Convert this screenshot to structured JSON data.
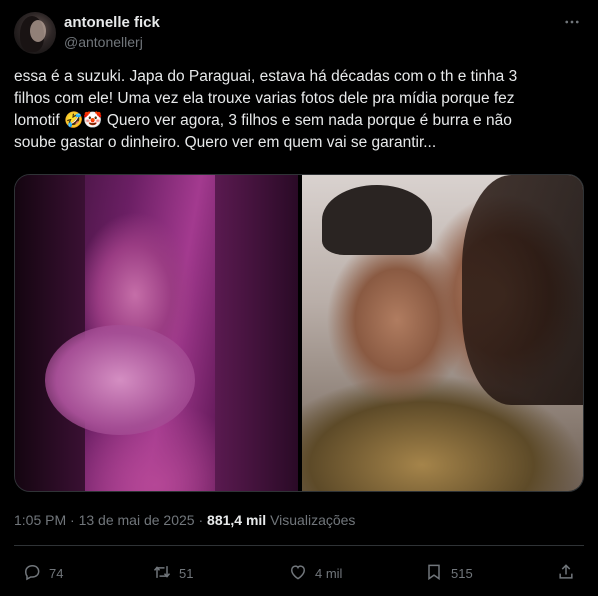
{
  "author": {
    "name": "antonelle fick",
    "handle": "@antonellerj"
  },
  "tweet": {
    "lines": [
      "essa é a suzuki. Japa do Paraguai, estava há décadas com o th e tinha 3",
      "filhos com ele! Uma vez ela trouxe varias fotos dele pra mídia porque fez",
      "lomotif 🤣🤡  Quero ver agora, 3 filhos e sem nada porque é burra e não",
      "soube gastar o dinheiro. Quero ver em quem vai se garantir..."
    ]
  },
  "meta": {
    "time": "1:05 PM",
    "separator": " · ",
    "date": "13 de mai de 2025",
    "views_count": "881,4 mil",
    "views_label": "Visualizações"
  },
  "actions": {
    "replies": "74",
    "reposts": "51",
    "likes": "4 mil",
    "bookmarks": "515"
  },
  "icons": {
    "more": "more-horizontal-icon",
    "reply": "reply-icon",
    "repost": "repost-icon",
    "like": "heart-icon",
    "bookmark": "bookmark-icon",
    "share": "share-icon"
  },
  "colors": {
    "background": "#000000",
    "text": "#e7e9ea",
    "muted": "#71767b",
    "border": "#2f3336"
  }
}
